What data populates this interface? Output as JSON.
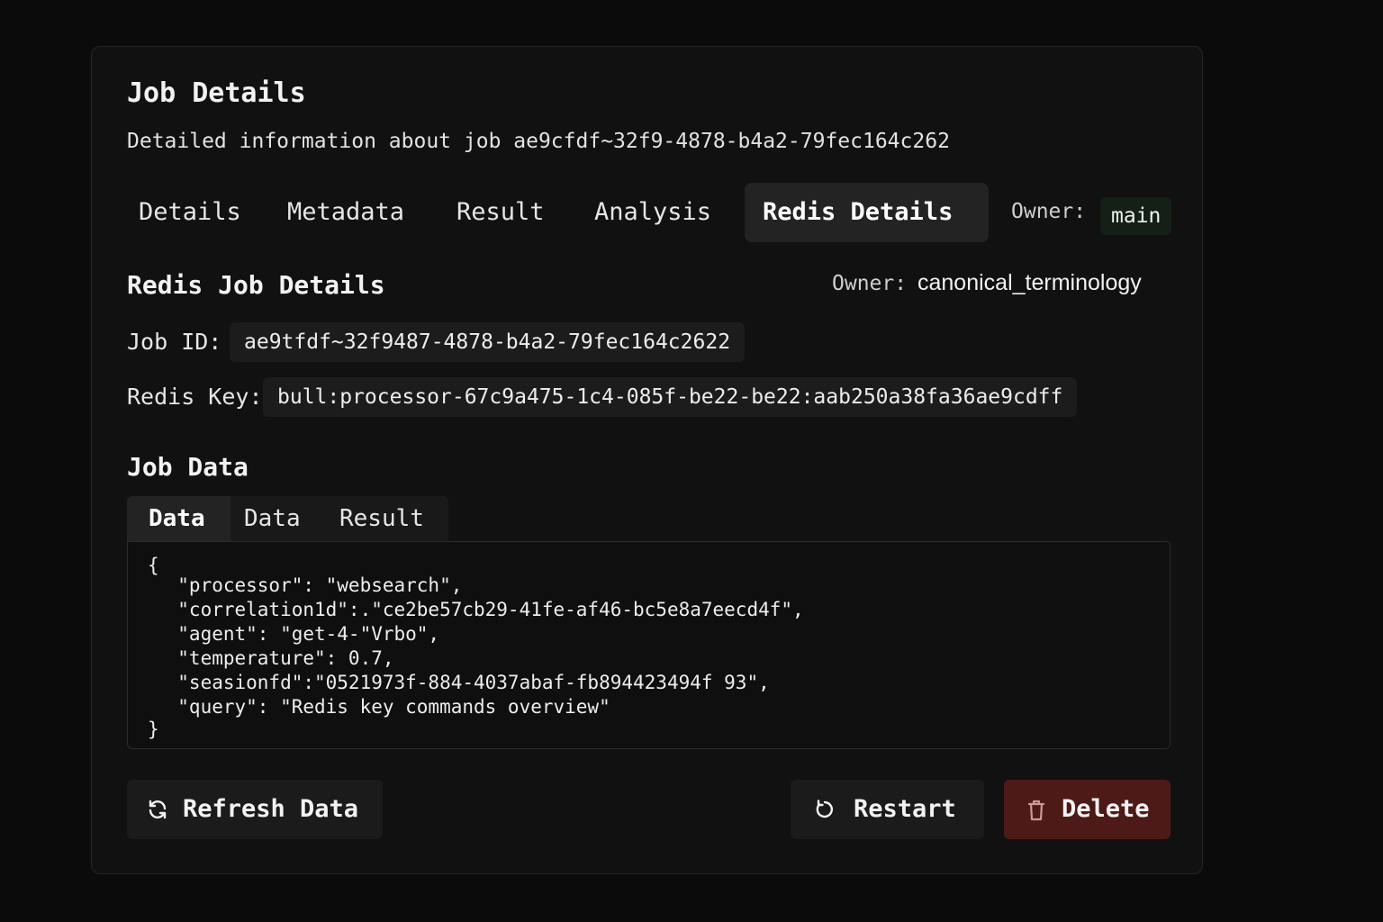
{
  "header": {
    "title": "Job Details",
    "subtitle": "Detailed information about job ae9cfdf~32f9-4878-b4a2-79fec164c262"
  },
  "tabs": [
    {
      "label": "Details"
    },
    {
      "label": "Metadata"
    },
    {
      "label": "Result"
    },
    {
      "label": "Analysis"
    },
    {
      "label": "Redis Details",
      "active": true
    }
  ],
  "owner_top": {
    "label": "Owner:",
    "value": "main"
  },
  "redis": {
    "title": "Redis Job Details",
    "owner_label": "Owner:",
    "owner_value": "canonical_terminology",
    "job_id_label": "Job ID:",
    "job_id_value": "ae9tfdf~32f9487-4878-b4a2-79fec164c2622",
    "redis_key_label": "Redis Key:",
    "redis_key_value": "bull:processor-67c9a475-1c4-085f-be22-be22:aab250a38fa36ae9cdff"
  },
  "job_data": {
    "title": "Job Data",
    "tabs": [
      {
        "label": "Data",
        "active": true
      },
      {
        "label": "Data"
      },
      {
        "label": "Result"
      }
    ],
    "code_lines": [
      "{",
      "  \"processor\": \"websearch\",",
      "  \"correlation1d\":.\"ce2be57cb29-41fe-af46-bc5e8a7eecd4f\",",
      "  \"agent\": \"get-4-\"Vrbo\",",
      "  \"temperature\": 0.7,",
      "  \"seasionfd\":\"0521973f-884-4037abaf-fb894423494f 93\",",
      "  \"query\": \"Redis key commands overview\"",
      "}"
    ]
  },
  "actions": {
    "refresh_label": "Refresh Data",
    "restart_label": "Restart",
    "delete_label": "Delete"
  },
  "icons": {
    "refresh": "refresh-icon",
    "restart": "restart-icon",
    "delete": "trash-icon"
  },
  "colors": {
    "background": "#0b0b0b",
    "card": "#111111",
    "active_tab": "#232323",
    "owner_badge": "#142016",
    "delete_button": "#4d1a18"
  }
}
